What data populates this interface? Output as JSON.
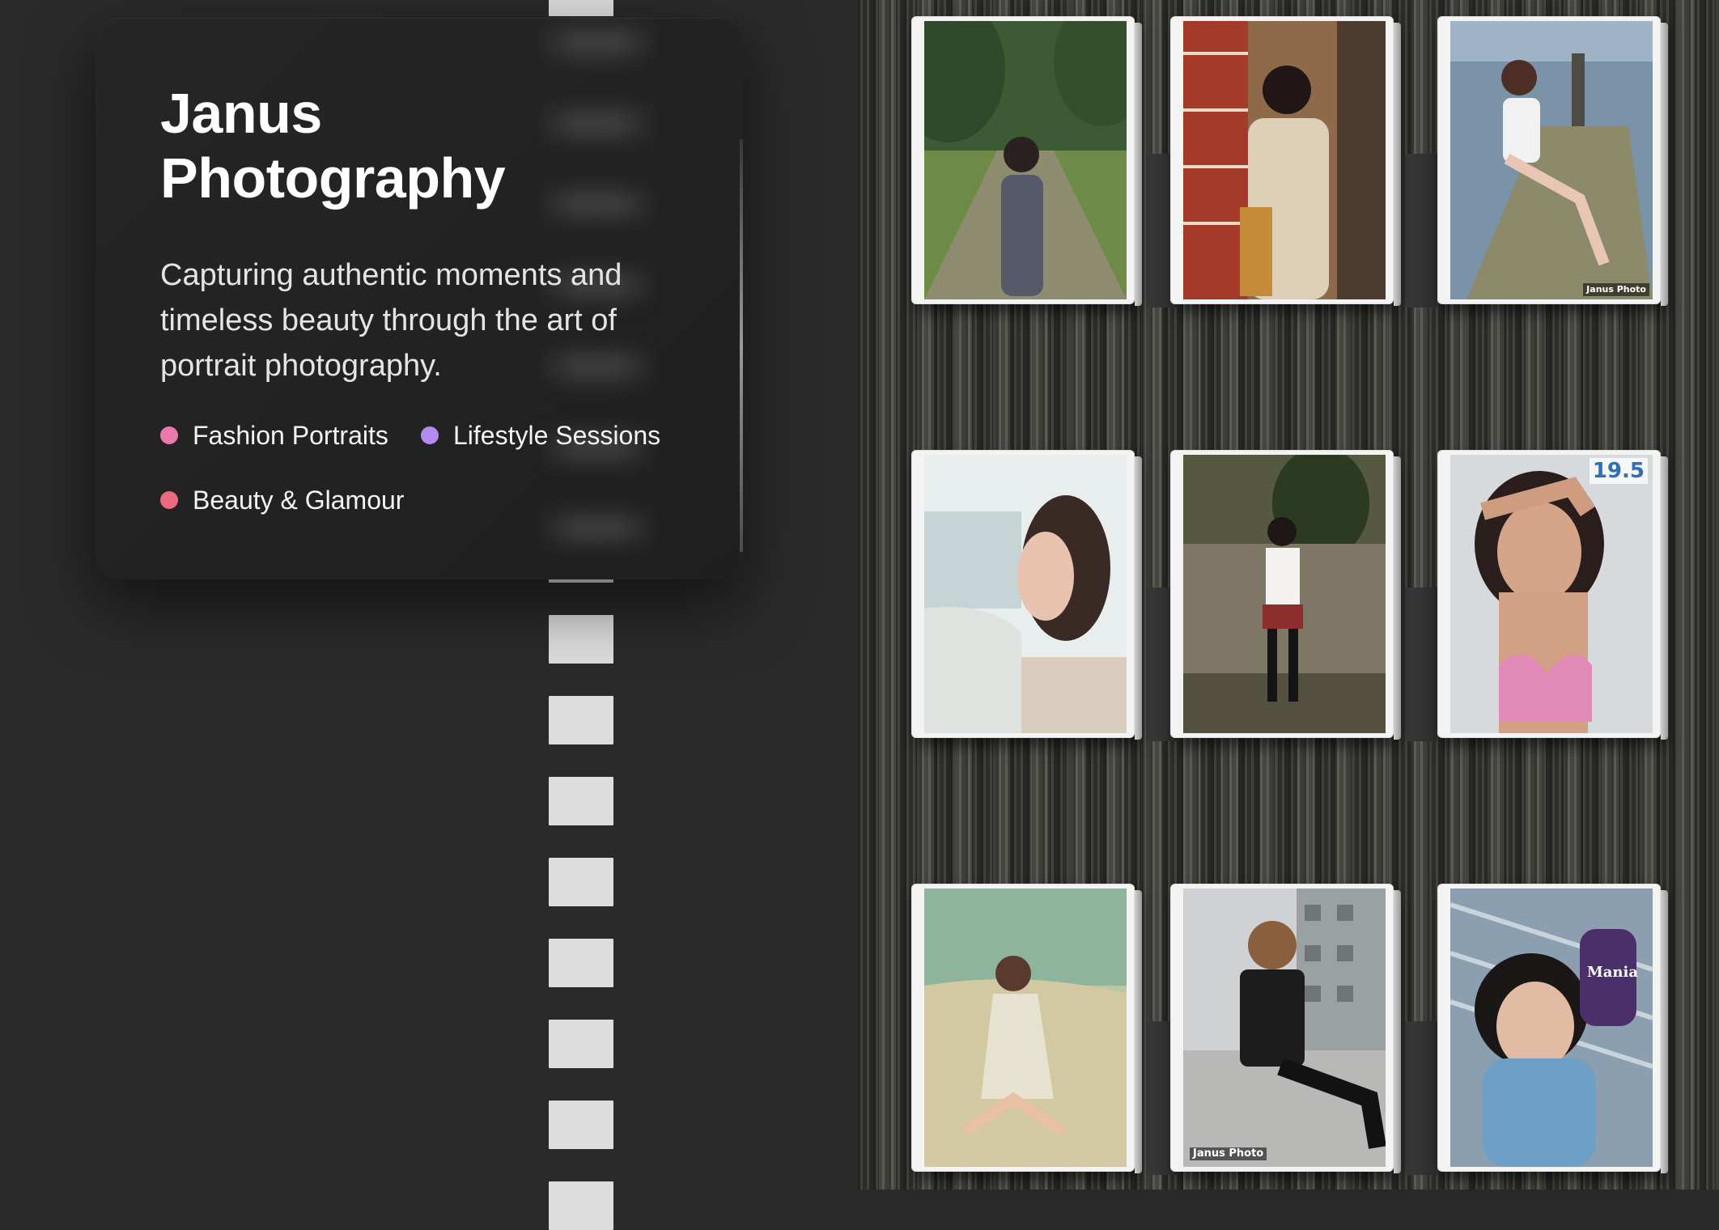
{
  "hero": {
    "title_line1": "Janus",
    "title_line2": "Photography",
    "tagline": "Capturing authentic moments and timeless beauty through the art of portrait photography.",
    "tags": [
      {
        "label": "Fashion Portraits",
        "color": "#e87aad"
      },
      {
        "label": "Lifestyle Sessions",
        "color": "#b48cf0"
      },
      {
        "label": "Beauty & Glamour",
        "color": "#ea6b7f"
      }
    ]
  },
  "gallery": {
    "photos": [
      {
        "name": "park-portrait",
        "watermark": ""
      },
      {
        "name": "library-portrait",
        "watermark": ""
      },
      {
        "name": "pier-portrait",
        "watermark": "Janus Photo"
      },
      {
        "name": "beach-profile-portrait",
        "watermark": ""
      },
      {
        "name": "schoolgirl-wall-portrait",
        "watermark": ""
      },
      {
        "name": "bikini-smile-portrait",
        "watermark": "19.5"
      },
      {
        "name": "seaside-dress-portrait",
        "watermark": ""
      },
      {
        "name": "city-street-portrait",
        "watermark": "Janus Photo"
      },
      {
        "name": "scarf-closeup-portrait",
        "watermark": "Mania"
      }
    ]
  }
}
